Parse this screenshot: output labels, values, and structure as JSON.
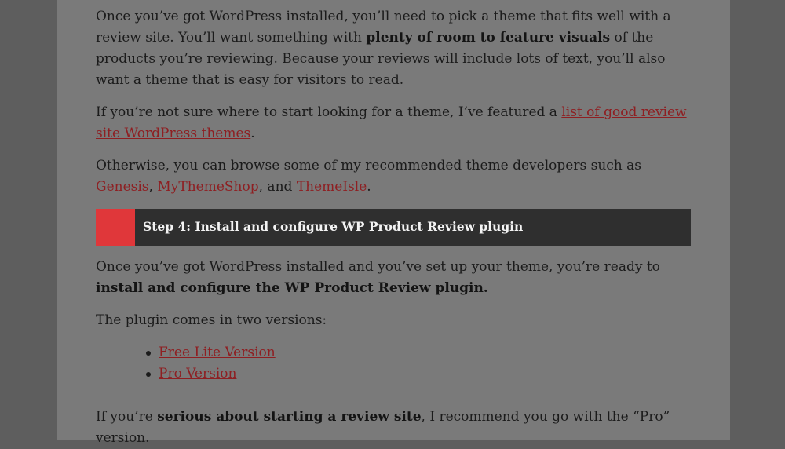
{
  "article": {
    "p1": {
      "t1": "Once you’ve got WordPress installed, you’ll need to pick a theme that fits well with a review site. You’ll want something with ",
      "b1": "plenty of room to feature visuals",
      "t2": " of the products you’re reviewing. Because your reviews will include lots of text, you’ll also want a theme that is easy for visitors to read."
    },
    "p2": {
      "t1": "If you’re not sure where to start looking for a theme, I’ve featured a ",
      "link": "list of good review site WordPress themes",
      "t2": "."
    },
    "p3": {
      "t1": "Otherwise, you can browse some of my recommended theme developers such as ",
      "link1": "Genesis",
      "sep1": ", ",
      "link2": "MyThemeShop",
      "sep2": ", and ",
      "link3": "ThemeIsle",
      "t2": "."
    },
    "step_heading": "Step 4: Install and configure WP Product Review plugin",
    "p4": {
      "t1": "Once you’ve got WordPress installed and you’ve set up your theme, you’re ready to ",
      "b1": "install and configure the WP Product Review plugin."
    },
    "p5": "The plugin comes in two versions:",
    "versions": [
      "Free Lite Version",
      "Pro Version"
    ],
    "p6": {
      "t1": "If you’re ",
      "b1": "serious about starting a review site",
      "t2": ", I recommend you go with the “Pro” version."
    }
  },
  "colors": {
    "overlay_outer": "#5e5e5e",
    "page_bg": "#7a7a7a",
    "link": "#8e1f22",
    "banner_bg": "#2f2f2f",
    "banner_accent": "#e0373a"
  }
}
